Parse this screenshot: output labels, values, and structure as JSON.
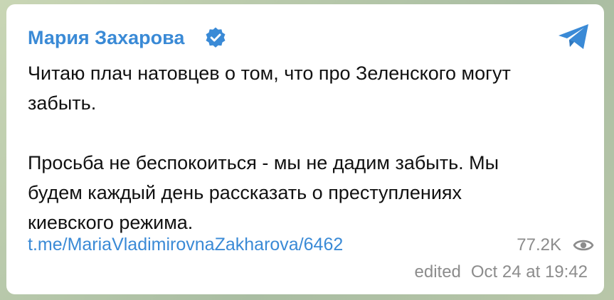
{
  "post": {
    "channel_name": "Мария Захарова",
    "verified_icon": "verified-badge-icon",
    "share_icon": "telegram-send-icon",
    "paragraphs": [
      "Читаю плач натовцев о том, что про Зеленского могут\nзабыть.",
      "Просьба не беспокоиться - мы не дадим забыть. Мы\nбудем каждый день рассказать о преступлениях\nкиевского режима."
    ],
    "link": "t.me/MariaVladimirovnaZakharova/6462",
    "views": "77.2K",
    "views_icon": "eye-icon",
    "edited_label": "edited",
    "timestamp": "Oct 24 at 19:42"
  },
  "colors": {
    "accent": "#3a8ad6",
    "meta_text": "#8c8c8c",
    "body_text": "#111111",
    "bubble_bg": "#ffffff"
  }
}
